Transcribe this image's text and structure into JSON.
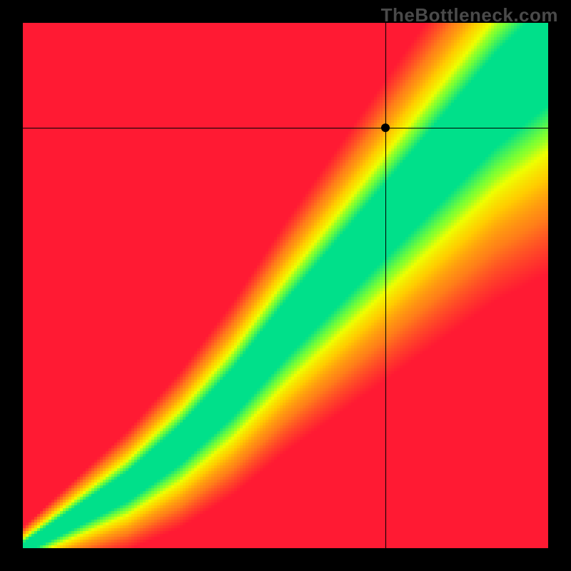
{
  "watermark": "TheBottleneck.com",
  "chart_data": {
    "type": "heatmap",
    "title": "",
    "xlabel": "",
    "ylabel": "",
    "xlim": [
      0,
      1
    ],
    "ylim": [
      0,
      1
    ],
    "color_scale": [
      "#ff1a33",
      "#ff7a1a",
      "#ffcc00",
      "#eeff00",
      "#7aff33",
      "#00e08a"
    ],
    "optimal_band": {
      "description": "green ridge where y ≈ f(x)",
      "center_curve_points": [
        [
          0.0,
          0.0
        ],
        [
          0.1,
          0.06
        ],
        [
          0.2,
          0.12
        ],
        [
          0.3,
          0.2
        ],
        [
          0.4,
          0.3
        ],
        [
          0.5,
          0.42
        ],
        [
          0.6,
          0.53
        ],
        [
          0.7,
          0.64
        ],
        [
          0.8,
          0.75
        ],
        [
          0.9,
          0.86
        ],
        [
          1.0,
          0.95
        ]
      ],
      "half_width_fraction_at_x0": 0.01,
      "half_width_fraction_at_x1": 0.09
    },
    "crosshair": {
      "x": 0.69,
      "y": 0.8
    },
    "marker": {
      "x": 0.69,
      "y": 0.8
    },
    "grid_resolution": 184
  }
}
